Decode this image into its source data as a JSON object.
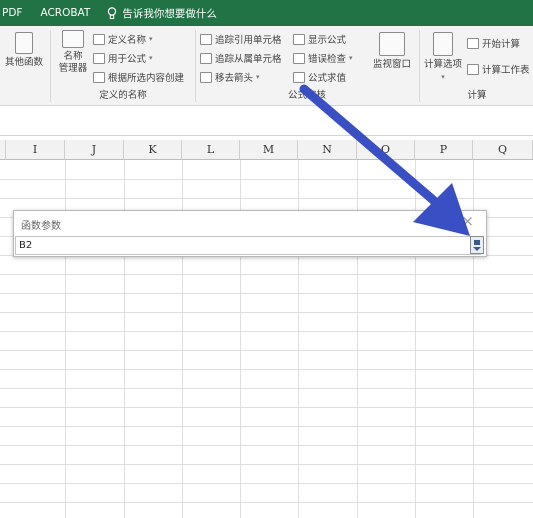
{
  "tabs": [
    "PDF",
    "ACROBAT"
  ],
  "tell_me": "告诉我你想要做什么",
  "ribbon": {
    "more_functions": "其他函数",
    "name_manager": "名称\n管理器",
    "defined_names": {
      "define_name": "定义名称",
      "use_in_formula": "用于公式",
      "create_from_selection": "根据所选内容创建",
      "group_label": "定义的名称"
    },
    "formula_auditing": {
      "trace_precedents": "追踪引用单元格",
      "trace_dependents": "追踪从属单元格",
      "remove_arrows": "移去箭头",
      "show_formulas": "显示公式",
      "error_checking": "错误检查",
      "evaluate_formula": "公式求值",
      "watch_window": "监视窗口",
      "group_label": "公式审核"
    },
    "calculation": {
      "calc_options": "计算选项",
      "calc_now": "开始计算",
      "calc_sheet": "计算工作表",
      "group_label": "计算"
    }
  },
  "columns": [
    "I",
    "J",
    "K",
    "L",
    "M",
    "N",
    "O",
    "P",
    "Q"
  ],
  "dialog": {
    "title": "函数参数",
    "close": "×",
    "value": "B2"
  },
  "colors": {
    "accent_green": "#217346",
    "arrow": "#3b4fc4"
  }
}
